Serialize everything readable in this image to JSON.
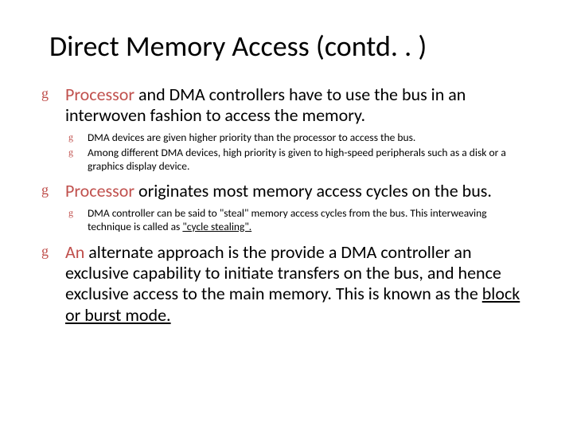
{
  "title": "Direct Memory Access (contd. . )",
  "bullets": [
    {
      "lead": "Processor",
      "rest": " and DMA controllers have to use the bus in an interwoven fashion to access the memory.",
      "sub": [
        "DMA devices are given higher priority than the processor to access the bus.",
        "Among different DMA devices, high priority is given to high-speed peripherals such as a disk or a graphics display device."
      ]
    },
    {
      "lead": "Processor",
      "rest": " originates most memory access cycles on the bus.",
      "sub_html": [
        "DMA controller can be said to \"steal\" memory access cycles from the bus. This interweaving technique is called as <span class=\"underline\">\"cycle stealing\".</span>"
      ]
    },
    {
      "lead": "An",
      "rest_html": " alternate approach is the provide a DMA controller an exclusive capability to initiate transfers on the bus, and hence exclusive access to the main memory. This is known as the <span class=\"underline\">block or burst mode.</span>"
    }
  ]
}
